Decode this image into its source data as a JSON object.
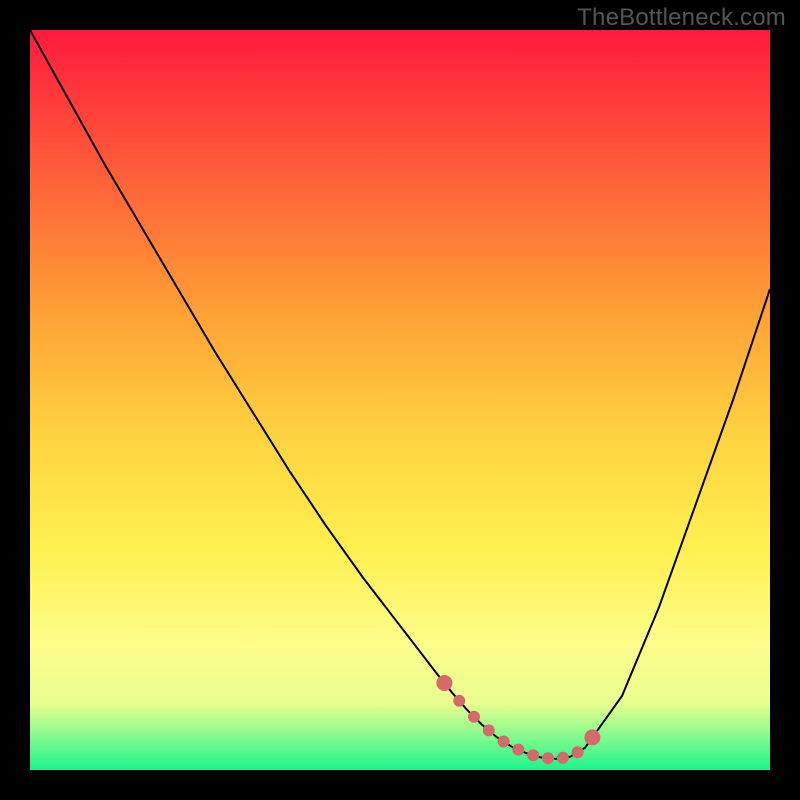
{
  "watermark": "TheBottleneck.com",
  "colors": {
    "top": "#ff1a3c",
    "mid1": "#ff593a",
    "mid2": "#ffa035",
    "mid3": "#ffd340",
    "mid4": "#fff050",
    "mid5": "#fdfd8a",
    "mid6": "#e9ff90",
    "bottom": "#1bf58a",
    "curve": "#000000",
    "dot": "#d46a6a"
  },
  "chart_data": {
    "type": "line",
    "title": "",
    "xlabel": "",
    "ylabel": "",
    "xlim": [
      0,
      100
    ],
    "ylim": [
      0,
      100
    ],
    "x": [
      0,
      5,
      10,
      15,
      20,
      25,
      30,
      35,
      40,
      45,
      50,
      55,
      57,
      59,
      61,
      63,
      65,
      67,
      69,
      71,
      73,
      75,
      80,
      85,
      90,
      95,
      100
    ],
    "values": [
      100,
      91,
      82,
      73.5,
      65,
      56.5,
      48.5,
      40.5,
      33,
      26,
      19.5,
      13,
      10.5,
      8.2,
      6.2,
      4.5,
      3.2,
      2.3,
      1.7,
      1.5,
      1.8,
      3,
      10,
      22,
      36,
      50,
      65
    ],
    "flat_dots_x": [
      56,
      58,
      60,
      62,
      64,
      66,
      68,
      70,
      72,
      74,
      76
    ]
  }
}
